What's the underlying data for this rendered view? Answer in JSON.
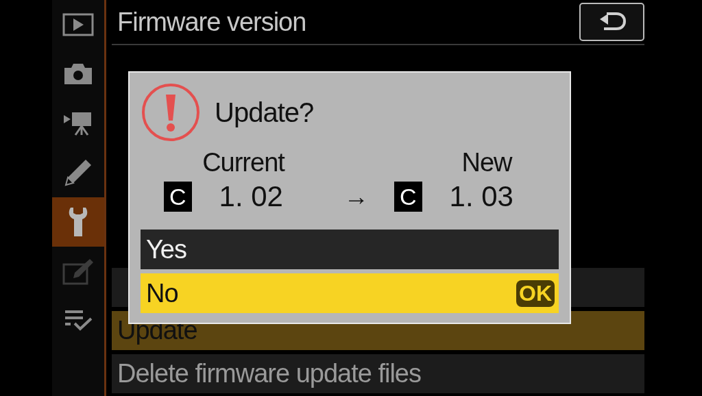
{
  "sidebar": {
    "items": [
      {
        "kind": "playback",
        "selected": false,
        "dimmed": false
      },
      {
        "kind": "camera",
        "selected": false,
        "dimmed": false
      },
      {
        "kind": "movie",
        "selected": false,
        "dimmed": false
      },
      {
        "kind": "pencil",
        "selected": false,
        "dimmed": false
      },
      {
        "kind": "wrench",
        "selected": true,
        "dimmed": false
      },
      {
        "kind": "retouch",
        "selected": false,
        "dimmed": true
      },
      {
        "kind": "list",
        "selected": false,
        "dimmed": false
      }
    ]
  },
  "header": {
    "title": "Firmware version"
  },
  "menu": {
    "items": [
      {
        "selected": false
      },
      {
        "label": "Update",
        "selected": true
      },
      {
        "label": "Delete firmware update files",
        "selected": false
      }
    ]
  },
  "dialog": {
    "title": "Update?",
    "current_label": "Current",
    "new_label": "New",
    "current": {
      "badge": "C",
      "version": "1. 02"
    },
    "arrow": "→",
    "new": {
      "badge": "C",
      "version": "1. 03"
    },
    "options": [
      {
        "label": "Yes",
        "selected": false
      },
      {
        "label": "No",
        "selected": true,
        "key": "OK"
      }
    ]
  }
}
